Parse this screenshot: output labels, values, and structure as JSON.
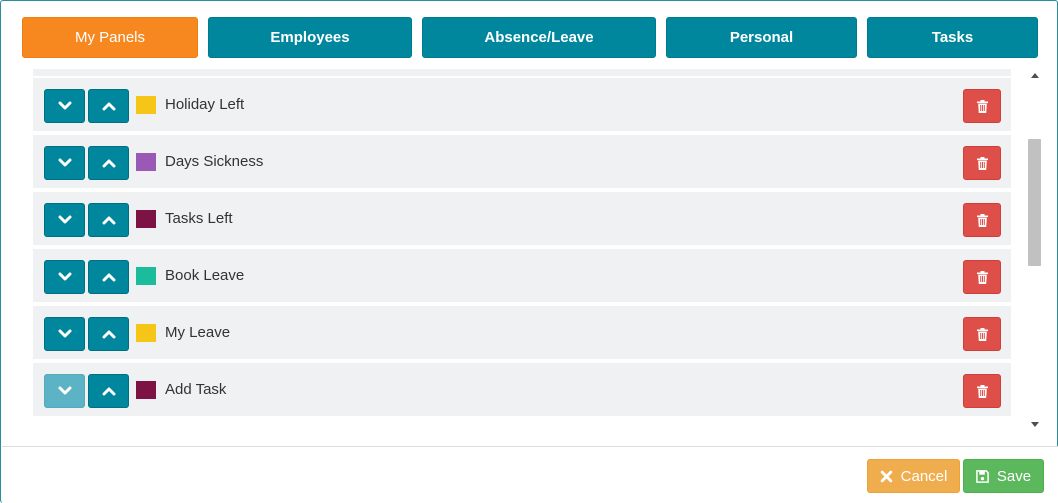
{
  "tabs": [
    {
      "label": "My Panels",
      "active": true
    },
    {
      "label": "Employees",
      "active": false
    },
    {
      "label": "Absence/Leave",
      "active": false
    },
    {
      "label": "Personal",
      "active": false
    },
    {
      "label": "Tasks",
      "active": false
    }
  ],
  "panels": [
    {
      "label": "Holiday Left",
      "color": "#f5c518",
      "down_enabled": true,
      "up_enabled": true
    },
    {
      "label": "Days Sickness",
      "color": "#9b59b6",
      "down_enabled": true,
      "up_enabled": true
    },
    {
      "label": "Tasks Left",
      "color": "#7d1345",
      "down_enabled": true,
      "up_enabled": true
    },
    {
      "label": "Book Leave",
      "color": "#1abc9c",
      "down_enabled": true,
      "up_enabled": true
    },
    {
      "label": "My Leave",
      "color": "#f5c518",
      "down_enabled": true,
      "up_enabled": true
    },
    {
      "label": "Add Task",
      "color": "#7d1345",
      "down_enabled": false,
      "up_enabled": true
    }
  ],
  "footer": {
    "cancel_label": "Cancel",
    "save_label": "Save"
  },
  "colors": {
    "tab_active": "#f7871f",
    "tab": "#00879e",
    "delete": "#df4f4a",
    "cancel": "#f0ad4e",
    "save": "#5cb85c"
  }
}
